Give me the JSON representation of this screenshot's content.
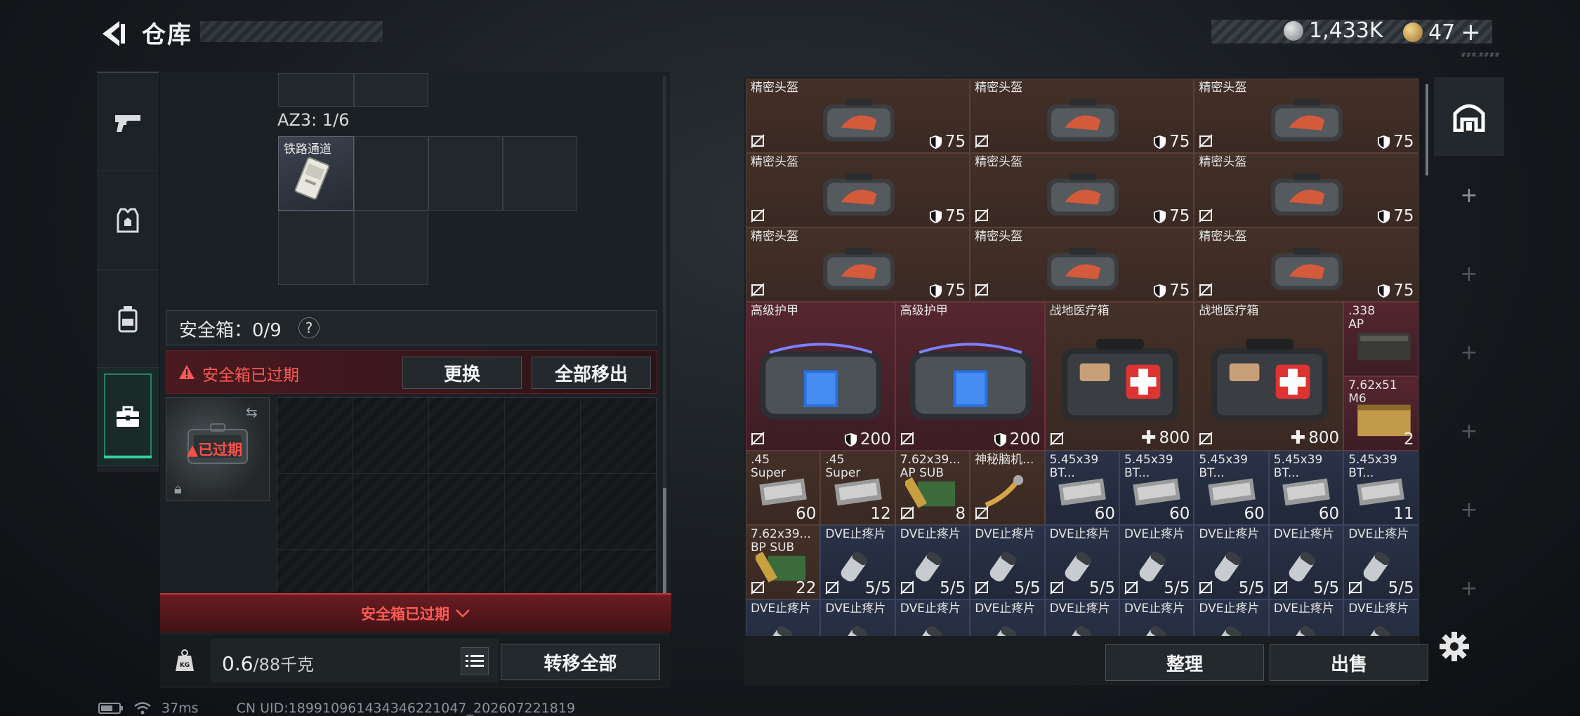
{
  "header": {
    "title": "仓库",
    "currency_1": "1,433K",
    "currency_2": "47",
    "currency_2_plus": "+",
    "tiny_label": "###.####"
  },
  "colors": {
    "accent": "#36d39e",
    "warning_red": "#ff5a55",
    "item_brown": "#3e2b25",
    "item_red": "#4c222a",
    "item_blue": "#262d41"
  },
  "left_tabs": [
    {
      "icon": "pistol-icon"
    },
    {
      "icon": "armor-vest-icon"
    },
    {
      "icon": "backpack-icon"
    },
    {
      "icon": "briefcase-icon",
      "active": true
    }
  ],
  "container": {
    "az3_label": "AZ3: 1/6",
    "railcard_label": "铁路通道"
  },
  "safe_box": {
    "label": "安全箱：0/9",
    "help": "?",
    "expired_text": "安全箱已过期",
    "replace_button": "更换",
    "move_all_button": "全部移出",
    "case_expired_label": "已过期",
    "bottom_expired": "安全箱已过期"
  },
  "weight": {
    "current": "0.6",
    "max": "/88千克",
    "kg_icon": "KG",
    "transfer_all_button": "转移全部"
  },
  "stash_items": [
    {
      "name": "精密头盔",
      "value": "75",
      "type": "helmet",
      "color": "brown"
    },
    {
      "name": "精密头盔",
      "value": "75",
      "type": "helmet",
      "color": "brown"
    },
    {
      "name": "精密头盔",
      "value": "75",
      "type": "helmet",
      "color": "brown"
    },
    {
      "name": "精密头盔",
      "value": "75",
      "type": "helmet",
      "color": "brown"
    },
    {
      "name": "精密头盔",
      "value": "75",
      "type": "helmet",
      "color": "brown"
    },
    {
      "name": "精密头盔",
      "value": "75",
      "type": "helmet",
      "color": "brown"
    },
    {
      "name": "精密头盔",
      "value": "75",
      "type": "helmet",
      "color": "brown"
    },
    {
      "name": "精密头盔",
      "value": "75",
      "type": "helmet",
      "color": "brown"
    },
    {
      "name": "精密头盔",
      "value": "75",
      "type": "helmet",
      "color": "brown"
    },
    {
      "name": "高级护甲",
      "value": "200",
      "type": "armor",
      "color": "red"
    },
    {
      "name": "高级护甲",
      "value": "200",
      "type": "armor",
      "color": "red"
    },
    {
      "name": "战地医疗箱",
      "value": "800",
      "type": "medkit",
      "color": "brown"
    },
    {
      "name": "战地医疗箱",
      "value": "800",
      "type": "medkit",
      "color": "brown"
    },
    {
      "name": ".338\nAP",
      "value": "",
      "type": "ammo-box",
      "color": "red"
    },
    {
      "name": "7.62x51\nM6",
      "value": "2",
      "type": "ammo-crate",
      "color": "red"
    },
    {
      "name": ".45\nSuper",
      "value": "60",
      "type": "ammo",
      "color": "brown"
    },
    {
      "name": ".45\nSuper",
      "value": "12",
      "type": "ammo",
      "color": "brown"
    },
    {
      "name": "7.62x39...\nAP SUB",
      "value": "8",
      "type": "ammo-green",
      "color": "brown"
    },
    {
      "name": "神秘脑机...",
      "value": "",
      "type": "chip",
      "color": "brown"
    },
    {
      "name": "5.45x39\nBT...",
      "value": "60",
      "type": "ammo",
      "color": "blue"
    },
    {
      "name": "5.45x39\nBT...",
      "value": "60",
      "type": "ammo",
      "color": "blue"
    },
    {
      "name": "5.45x39\nBT...",
      "value": "60",
      "type": "ammo",
      "color": "blue"
    },
    {
      "name": "5.45x39\nBT...",
      "value": "60",
      "type": "ammo",
      "color": "blue"
    },
    {
      "name": "5.45x39\nBT...",
      "value": "11",
      "type": "ammo",
      "color": "blue"
    },
    {
      "name": "7.62x39...\nBP SUB",
      "value": "22",
      "type": "ammo-green",
      "color": "brown"
    },
    {
      "name": "DVE止疼片",
      "value": "5/5",
      "type": "pill",
      "color": "blue"
    },
    {
      "name": "DVE止疼片",
      "value": "5/5",
      "type": "pill",
      "color": "blue"
    },
    {
      "name": "DVE止疼片",
      "value": "5/5",
      "type": "pill",
      "color": "blue"
    },
    {
      "name": "DVE止疼片",
      "value": "5/5",
      "type": "pill",
      "color": "blue"
    },
    {
      "name": "DVE止疼片",
      "value": "5/5",
      "type": "pill",
      "color": "blue"
    },
    {
      "name": "DVE止疼片",
      "value": "5/5",
      "type": "pill",
      "color": "blue"
    },
    {
      "name": "DVE止疼片",
      "value": "5/5",
      "type": "pill",
      "color": "blue"
    },
    {
      "name": "DVE止疼片",
      "value": "5/5",
      "type": "pill",
      "color": "blue"
    },
    {
      "name": "DVE止疼片",
      "value": "",
      "type": "pill",
      "color": "blue"
    },
    {
      "name": "DVE止疼片",
      "value": "",
      "type": "pill",
      "color": "blue"
    },
    {
      "name": "DVE止疼片",
      "value": "",
      "type": "pill",
      "color": "blue"
    },
    {
      "name": "DVE止疼片",
      "value": "",
      "type": "pill",
      "color": "blue"
    },
    {
      "name": "DVE止疼片",
      "value": "",
      "type": "pill",
      "color": "blue"
    },
    {
      "name": "DVE止疼片",
      "value": "",
      "type": "pill",
      "color": "blue"
    },
    {
      "name": "DVE止疼片",
      "value": "",
      "type": "pill",
      "color": "blue"
    },
    {
      "name": "DVE止疼片",
      "value": "",
      "type": "pill",
      "color": "blue"
    },
    {
      "name": "DVE止疼片",
      "value": "",
      "type": "pill",
      "color": "blue"
    }
  ],
  "stash_buttons": {
    "sort": "整理",
    "sell": "出售"
  },
  "right_tabs": [
    {
      "icon": "stash-arch-icon"
    },
    {
      "icon": "plus-icon",
      "label": "+"
    },
    {
      "icon": "plus-icon",
      "label": "+"
    },
    {
      "icon": "plus-icon",
      "label": "+"
    },
    {
      "icon": "plus-icon",
      "label": "+"
    },
    {
      "icon": "plus-icon",
      "label": "+"
    },
    {
      "icon": "plus-icon",
      "label": "+"
    }
  ],
  "status_bar": {
    "ping": "37ms",
    "uid": "CN UID:18991096143434622104​7_202607221819"
  }
}
